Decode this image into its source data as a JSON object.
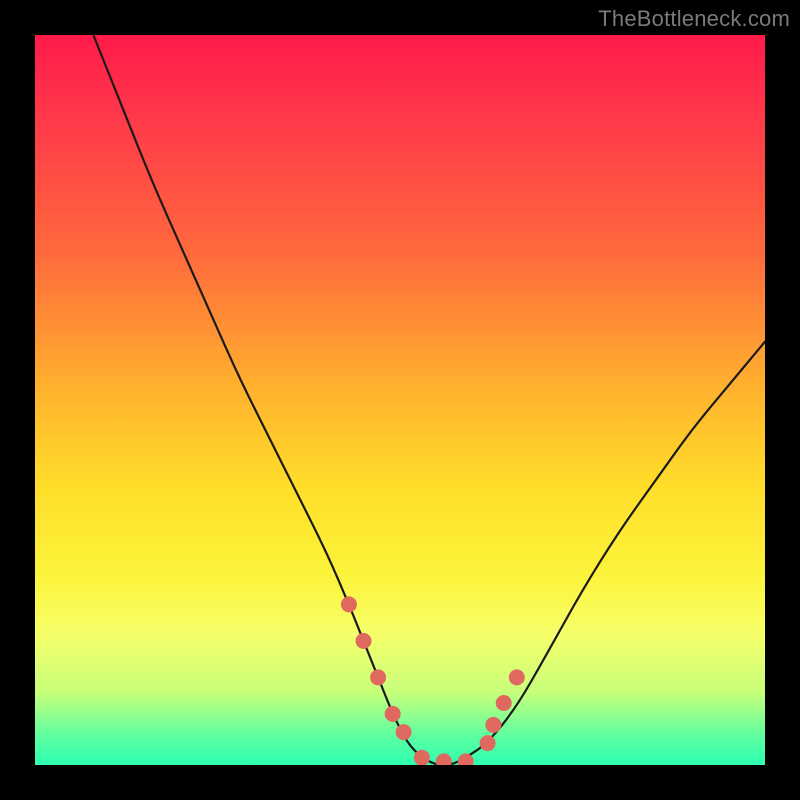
{
  "brand": {
    "text": "TheBottleneck.com"
  },
  "chart_data": {
    "type": "line",
    "title": "",
    "xlabel": "",
    "ylabel": "",
    "xlim": [
      0,
      100
    ],
    "ylim": [
      0,
      100
    ],
    "series": [
      {
        "name": "curve",
        "x": [
          8,
          12,
          16,
          20,
          24,
          28,
          32,
          36,
          40,
          43,
          45,
          47,
          49,
          51,
          53,
          55,
          57,
          59,
          62,
          66,
          70,
          75,
          80,
          85,
          90,
          95,
          100
        ],
        "values": [
          100,
          90,
          80,
          71,
          62,
          53,
          45,
          37,
          29,
          22,
          17,
          12,
          7,
          3,
          1,
          0,
          0,
          1,
          3,
          8,
          15,
          24,
          32,
          39,
          46,
          52,
          58
        ]
      }
    ],
    "markers": {
      "name": "dots",
      "color": "#e0695f",
      "x": [
        43,
        45,
        47,
        49,
        50.5,
        53,
        56,
        59,
        62,
        62.8,
        64.2,
        66
      ],
      "values": [
        22,
        17,
        12,
        7,
        4.5,
        1,
        0.5,
        0.5,
        3,
        5.5,
        8.5,
        12
      ]
    }
  },
  "colors": {
    "curve": "#1a1a1a",
    "marker": "#e0695f",
    "bg_top": "#ff1a4a",
    "bg_bottom": "#2dffb0",
    "frame": "#000000",
    "brand": "#7a7a7a"
  }
}
